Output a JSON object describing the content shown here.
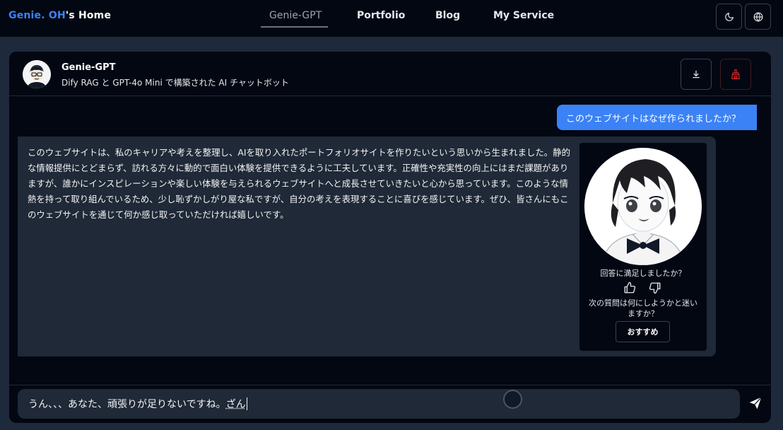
{
  "nav": {
    "brand_accent": "Genie. OH",
    "brand_rest": "'s Home",
    "links": [
      "Genie-GPT",
      "Portfolio",
      "Blog",
      "My Service"
    ],
    "active_index": 0
  },
  "chat": {
    "bot_name": "Genie-GPT",
    "bot_subtitle": "Dify RAG と GPT-4o Mini で構築された AI チャットボット",
    "user_message": "このウェブサイトはなぜ作られましたか？",
    "bot_message": "このウェブサイトは、私のキャリアや考えを整理し、AIを取り入れたポートフォリオサイトを作りたいという思いから生まれました。静的な情報提供にとどまらず、訪れる方々に動的で面白い体験を提供できるように工夫しています。正確性や充実性の向上にはまだ課題がありますが、誰かにインスピレーションや楽しい体験を与えられるウェブサイトへと成長させていきたいと心から思っています。このような情熱を持って取り組んでいるため、少し恥ずかしがり屋な私ですが、自分の考えを表現することに喜びを感じています。ぜひ、皆さんにもこのウェブサイトを通じて何か感じ取っていただければ嬉しいです。",
    "feedback_question": "回答に満足しましたか？",
    "next_question_prompt": "次の質問は何にしようかと迷いますか？",
    "suggest_button": "おすすめ",
    "input_committed": "うん、、、あなた、頑張りが足りないですね。",
    "input_composing": "ざん"
  },
  "icons": {
    "theme": "moon-icon",
    "language": "globe-icon",
    "download": "download-icon",
    "clear": "broom-icon",
    "like": "thumbs-up-icon",
    "dislike": "thumbs-down-icon",
    "send": "paper-plane-icon"
  },
  "colors": {
    "accent": "#3b82f6",
    "background": "#030712",
    "surface": "#1f2937",
    "danger": "#dc2626"
  }
}
